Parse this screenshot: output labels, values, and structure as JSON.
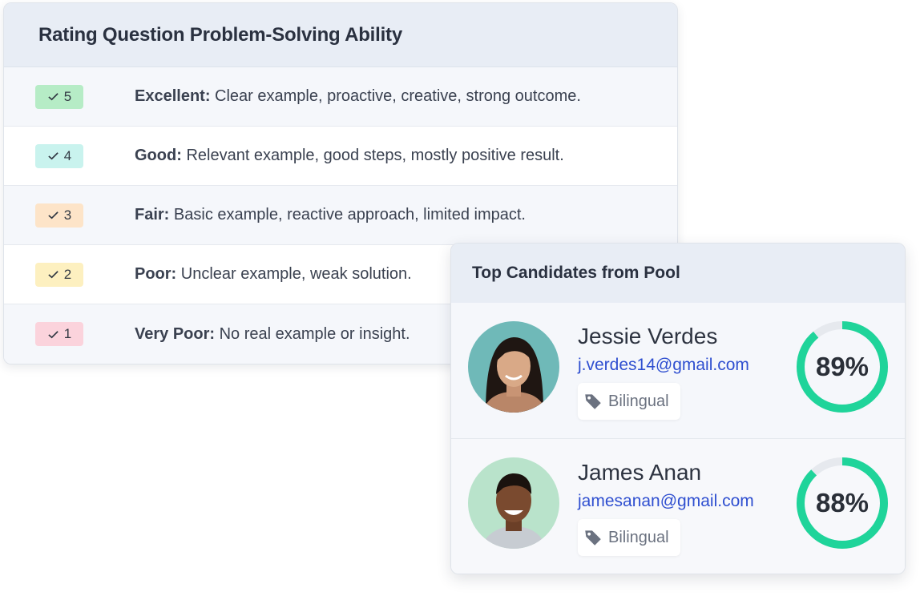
{
  "rating": {
    "title": "Rating Question Problem-Solving Ability",
    "rows": [
      {
        "score": "5",
        "label": "Excellent:",
        "desc": "Clear example, proactive, creative, strong outcome.",
        "color": "#b6ecc6"
      },
      {
        "score": "4",
        "label": "Good:",
        "desc": "Relevant example, good steps, mostly positive result.",
        "color": "#c9f3ee"
      },
      {
        "score": "3",
        "label": "Fair:",
        "desc": "Basic example, reactive approach, limited impact.",
        "color": "#fde4c8"
      },
      {
        "score": "2",
        "label": "Poor:",
        "desc": "Unclear example, weak solution.",
        "color": "#fdf0c0"
      },
      {
        "score": "1",
        "label": "Very Poor:",
        "desc": "No real example or insight.",
        "color": "#fbd3dc"
      }
    ]
  },
  "candidates": {
    "title": "Top Candidates from Pool",
    "items": [
      {
        "name": "Jessie Verdes",
        "email": "j.verdes14@gmail.com",
        "tag": "Bilingual",
        "score": "89%",
        "fraction": 0.89,
        "icon": "tag-icon"
      },
      {
        "name": "James Anan",
        "email": "jamesanan@gmail.com",
        "tag": "Bilingual",
        "score": "88%",
        "fraction": 0.88,
        "icon": "tag-icon"
      }
    ]
  },
  "colors": {
    "ring": "#1fd49a",
    "ring_track": "#e6e9ee",
    "email": "#2f4fd0"
  }
}
